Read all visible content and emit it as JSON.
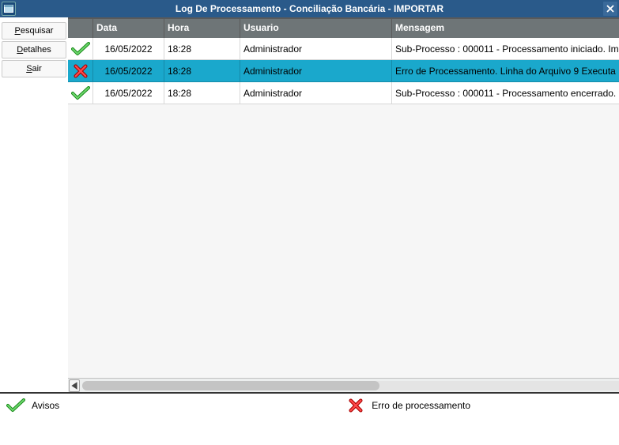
{
  "window": {
    "title": "Log De Processamento - Conciliação Bancária - IMPORTAR"
  },
  "sidebar": {
    "pesquisar": "Pesquisar",
    "detalhes": "Detalhes",
    "sair": "Sair"
  },
  "grid": {
    "headers": {
      "data": "Data",
      "hora": "Hora",
      "usuario": "Usuario",
      "mensagem": "Mensagem"
    },
    "rows": [
      {
        "status": "ok",
        "data": "16/05/2022",
        "hora": "18:28",
        "usuario": "Administrador",
        "mensagem": "Sub-Processo : 000011 - Processamento iniciado. Im"
      },
      {
        "status": "error",
        "data": "16/05/2022",
        "hora": "18:28",
        "usuario": "Administrador",
        "mensagem": "Erro de Processamento. Linha do Arquivo 9 Executa"
      },
      {
        "status": "ok",
        "data": "16/05/2022",
        "hora": "18:28",
        "usuario": "Administrador",
        "mensagem": "Sub-Processo : 000011 - Processamento encerrado."
      }
    ]
  },
  "footer": {
    "avisos": "Avisos",
    "erro": "Erro de processamento"
  }
}
